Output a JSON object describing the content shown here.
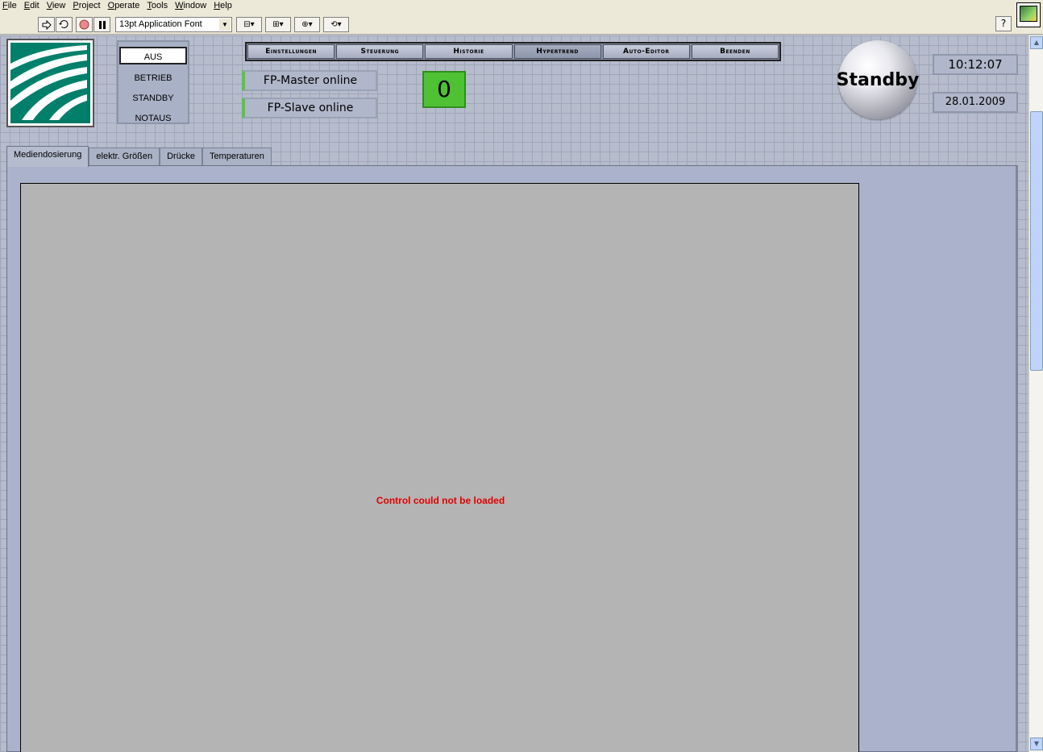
{
  "menu": [
    "File",
    "Edit",
    "View",
    "Project",
    "Operate",
    "Tools",
    "Window",
    "Help"
  ],
  "toolbar": {
    "font_selector": "13pt Application Font",
    "help_label": "?"
  },
  "modes": {
    "items": [
      "AUS",
      "BETRIEB",
      "STANDBY",
      "NOTAUS"
    ],
    "selected": "AUS"
  },
  "nav": {
    "buttons": [
      "Einstellungen",
      "Steuerung",
      "Historie",
      "Hypertrend",
      "Auto-Editor",
      "Beenden"
    ],
    "active": "Hypertrend"
  },
  "status": {
    "master": "FP-Master online",
    "slave": "FP-Slave online",
    "indicator_color": "#5cc24a"
  },
  "counter": {
    "value": "0",
    "color": "#4ec234"
  },
  "led": {
    "label": "Standby"
  },
  "clock": {
    "time": "10:12:07",
    "date": "28.01.2009"
  },
  "tabs": {
    "items": [
      "Mediendosierung",
      "elektr. Größen",
      "Drücke",
      "Temperaturen"
    ],
    "active": "Mediendosierung"
  },
  "content": {
    "error": "Control could not be loaded",
    "error_color": "#e00000"
  }
}
